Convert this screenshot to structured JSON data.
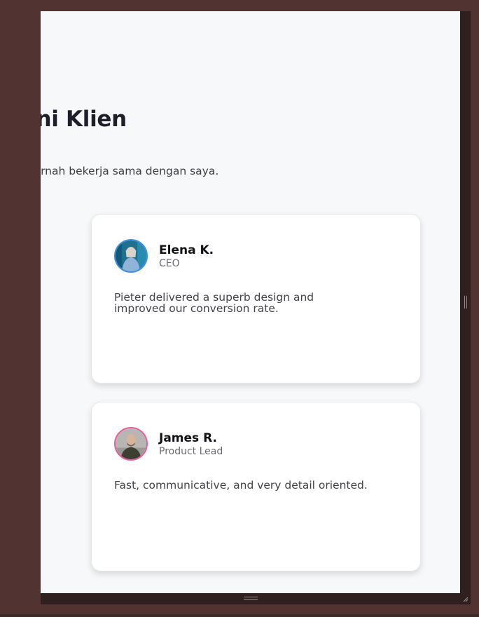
{
  "section": {
    "title": "Testimoni Klien",
    "subtitle": "Apa kata klien yang pernah bekerja sama dengan saya."
  },
  "testimonials": [
    {
      "name": "Elena K.",
      "role": "CEO",
      "quote": "Pieter delivered a superb design and improved our conversion rate.",
      "avatar_icon": "avatar-photo-icon",
      "ring_color": "#3d8fe3"
    },
    {
      "name": "James R.",
      "role": "Product Lead",
      "quote": "Fast, communicative, and very detail oriented.",
      "avatar_icon": "avatar-photo-icon",
      "ring_color": "#ec5aa0"
    }
  ],
  "colors": {
    "page_background": "#f7f8fa",
    "frame_background": "#513331",
    "title": "#1f1f2b",
    "card": "#ffffff"
  }
}
